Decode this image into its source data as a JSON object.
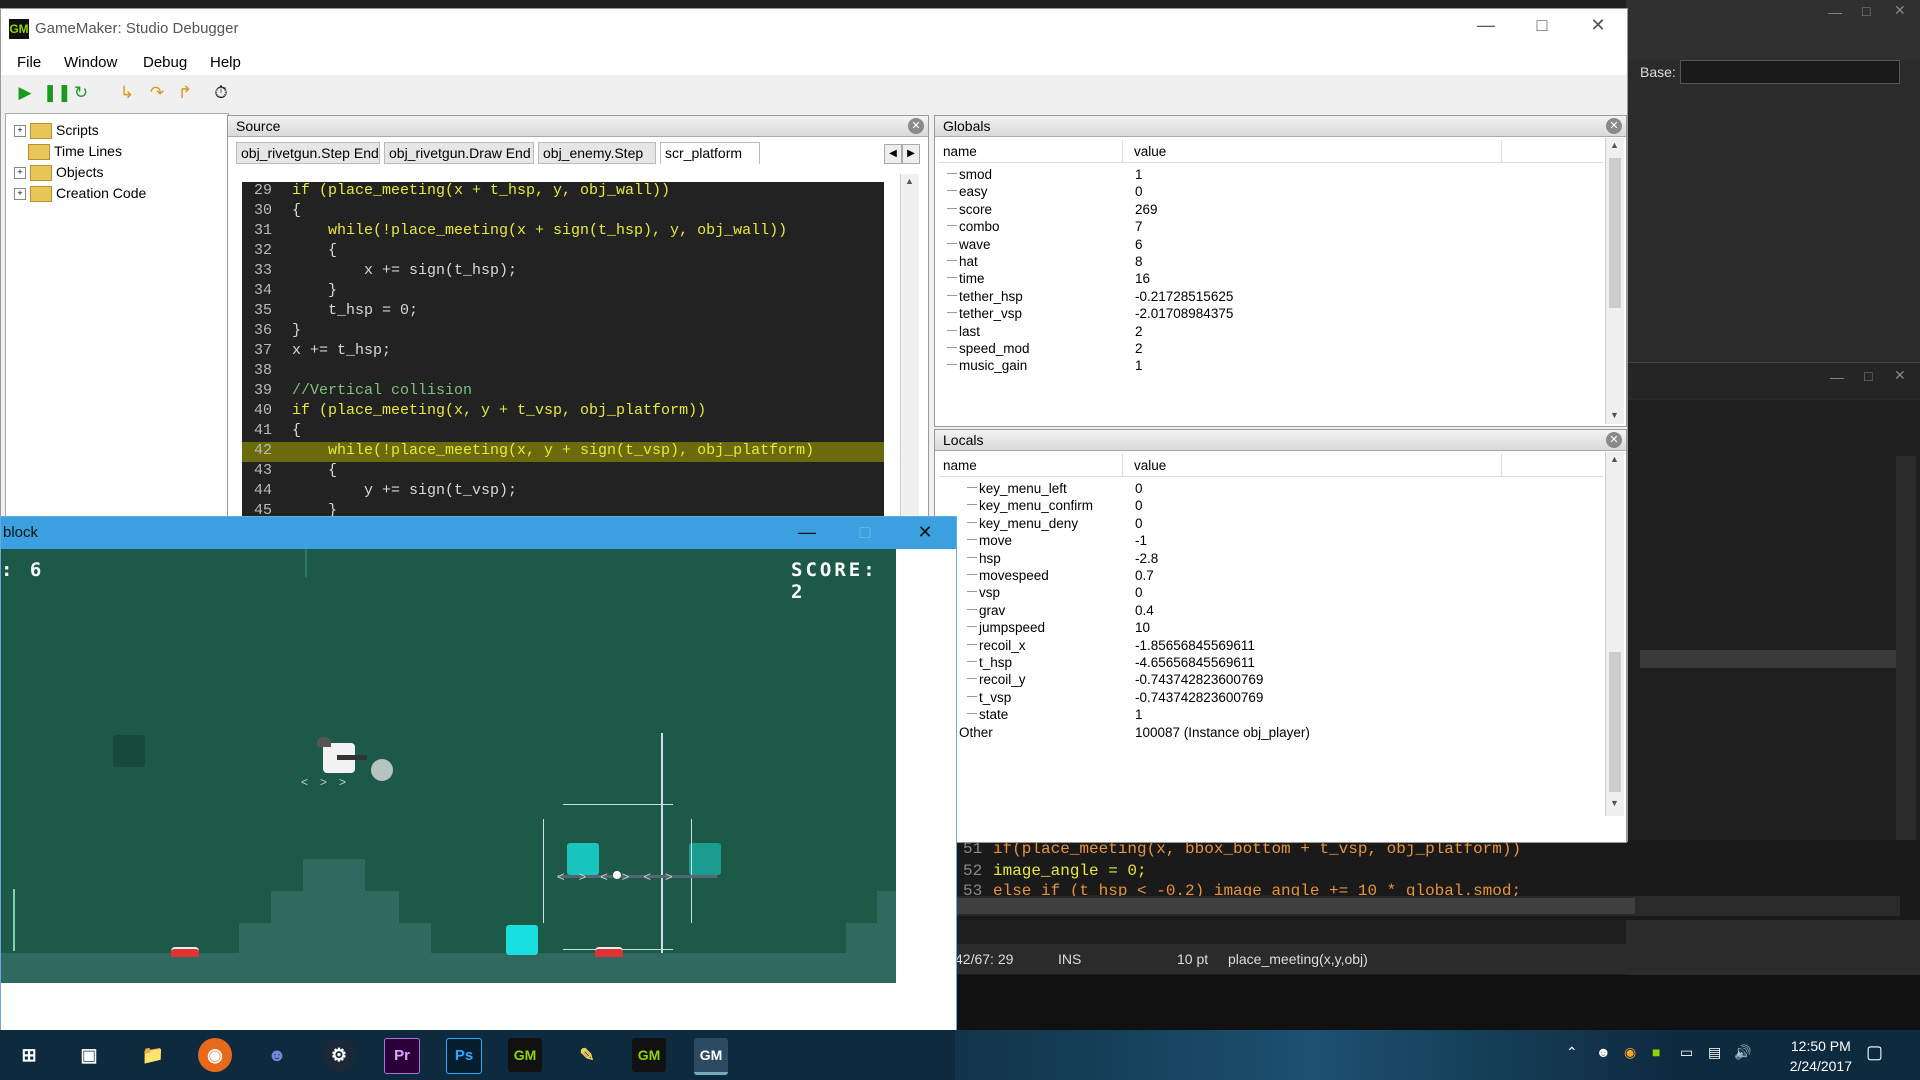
{
  "debugger": {
    "title": "GameMaker: Studio Debugger",
    "menu": [
      "File",
      "Window",
      "Debug",
      "Help"
    ],
    "toolbar": [
      "run-icon",
      "pause-icon",
      "restart-icon",
      "step-into-icon",
      "step-over-icon",
      "step-out-icon",
      "realtime-icon"
    ],
    "tree": [
      {
        "label": "Scripts",
        "expandable": true
      },
      {
        "label": "Time Lines",
        "expandable": false
      },
      {
        "label": "Objects",
        "expandable": true
      },
      {
        "label": "Creation Code",
        "expandable": true
      }
    ],
    "source": {
      "title": "Source",
      "tabs": [
        "obj_rivetgun.Step End",
        "obj_rivetgun.Draw End",
        "obj_enemy.Step",
        "scr_platform"
      ],
      "active_tab": 3,
      "current_line": 42,
      "lines": [
        {
          "no": "29",
          "text": "if (place_meeting(x + t_hsp, y, obj_wall))"
        },
        {
          "no": "30",
          "text": "{"
        },
        {
          "no": "31",
          "text": "    while(!place_meeting(x + sign(t_hsp), y, obj_wall))"
        },
        {
          "no": "32",
          "text": "    {"
        },
        {
          "no": "33",
          "text": "        x += sign(t_hsp);"
        },
        {
          "no": "34",
          "text": "    }"
        },
        {
          "no": "35",
          "text": "    t_hsp = 0;"
        },
        {
          "no": "36",
          "text": "}"
        },
        {
          "no": "37",
          "text": "x += t_hsp;"
        },
        {
          "no": "38",
          "text": ""
        },
        {
          "no": "39",
          "text": "//Vertical collision"
        },
        {
          "no": "40",
          "text": "if (place_meeting(x, y + t_vsp, obj_platform))"
        },
        {
          "no": "41",
          "text": "{"
        },
        {
          "no": "42",
          "text": "    while(!place_meeting(x, y + sign(t_vsp), obj_platform)"
        },
        {
          "no": "43",
          "text": "    {"
        },
        {
          "no": "44",
          "text": "        y += sign(t_vsp);"
        },
        {
          "no": "45",
          "text": "    }"
        }
      ]
    },
    "globals": {
      "title": "Globals",
      "col_name": "name",
      "col_value": "value",
      "rows": [
        {
          "name": "smod",
          "value": "1"
        },
        {
          "name": "easy",
          "value": "0"
        },
        {
          "name": "score",
          "value": "269"
        },
        {
          "name": "combo",
          "value": "7"
        },
        {
          "name": "wave",
          "value": "6"
        },
        {
          "name": "hat",
          "value": "8"
        },
        {
          "name": "time",
          "value": "16"
        },
        {
          "name": "tether_hsp",
          "value": "-0.21728515625"
        },
        {
          "name": "tether_vsp",
          "value": "-2.01708984375"
        },
        {
          "name": "last",
          "value": "2"
        },
        {
          "name": "speed_mod",
          "value": "2"
        },
        {
          "name": "music_gain",
          "value": "1"
        }
      ]
    },
    "locals": {
      "title": "Locals",
      "col_name": "name",
      "col_value": "value",
      "rows": [
        {
          "name": "key_menu_left",
          "value": "0"
        },
        {
          "name": "key_menu_confirm",
          "value": "0"
        },
        {
          "name": "key_menu_deny",
          "value": "0"
        },
        {
          "name": "move",
          "value": "-1"
        },
        {
          "name": "hsp",
          "value": "-2.8"
        },
        {
          "name": "movespeed",
          "value": "0.7"
        },
        {
          "name": "vsp",
          "value": "0"
        },
        {
          "name": "grav",
          "value": "0.4"
        },
        {
          "name": "jumpspeed",
          "value": "10"
        },
        {
          "name": "recoil_x",
          "value": "-1.85656845569611"
        },
        {
          "name": "t_hsp",
          "value": "-4.65656845569611"
        },
        {
          "name": "recoil_y",
          "value": "-0.743742823600769"
        },
        {
          "name": "t_vsp",
          "value": "-0.743742823600769"
        },
        {
          "name": "state",
          "value": "1"
        }
      ],
      "other": {
        "name": "Other",
        "value": "100087 (Instance obj_player)"
      }
    }
  },
  "game_window": {
    "title": "block",
    "hud_left": ": 6",
    "hud_right": "SCORE: 2"
  },
  "background_editor": {
    "base_label": "Base:",
    "code_lines": [
      {
        "no": "51",
        "text": "if(place_meeting(x, bbox_bottom + t_vsp, obj_platform))"
      },
      {
        "no": "52",
        "text": "image_angle = 0;"
      },
      {
        "no": "53",
        "text": "else if (t_hsp < -0.2) image_angle += 10 * global.smod;"
      }
    ],
    "status": {
      "position": "42/67: 29",
      "mode": "INS",
      "font_size": "10 pt",
      "hint": "place_meeting(x,y,obj)"
    }
  },
  "taskbar": {
    "time": "12:50 PM",
    "date": "2/24/2017",
    "apps": [
      "windows-start-icon",
      "task-view-icon",
      "file-explorer-icon",
      "firefox-icon",
      "discord-icon",
      "steam-icon",
      "premiere-icon",
      "photoshop-icon",
      "gamemaker-icon",
      "paint-icon",
      "gamemaker-icon",
      "gamemaker-active-icon"
    ]
  }
}
